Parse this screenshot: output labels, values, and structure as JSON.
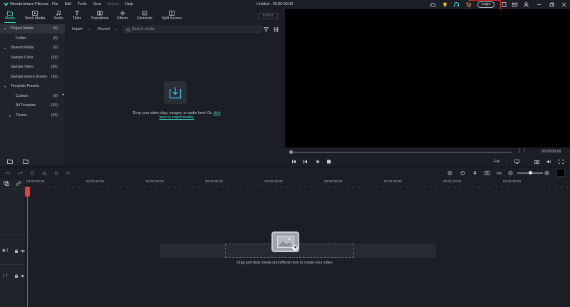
{
  "titlebar": {
    "app_name": "Wondershare Filmora",
    "menu": [
      "File",
      "Edit",
      "Tools",
      "View",
      "Export",
      "Help"
    ],
    "document_title": "Untitled : 00:00:00:00",
    "login_label": "Login"
  },
  "tabs": [
    {
      "label": "Media",
      "icon": "folder-icon",
      "active": true
    },
    {
      "label": "Stock Media",
      "icon": "stock-media-icon"
    },
    {
      "label": "Audio",
      "icon": "music-note-icon"
    },
    {
      "label": "Titles",
      "icon": "titles-icon"
    },
    {
      "label": "Transitions",
      "icon": "transitions-icon"
    },
    {
      "label": "Effects",
      "icon": "effects-icon"
    },
    {
      "label": "Elements",
      "icon": "elements-icon"
    },
    {
      "label": "Split Screen",
      "icon": "split-screen-icon"
    }
  ],
  "export_label": "Export",
  "tree": [
    {
      "label": "Project Media",
      "count": "(0)",
      "caret": "▾",
      "indent": 0,
      "selected": true
    },
    {
      "label": "Folder",
      "count": "(0)",
      "caret": "",
      "indent": 1
    },
    {
      "label": "Shared Media",
      "count": "(0)",
      "caret": "▸",
      "indent": 0
    },
    {
      "label": "Sample Color",
      "count": "(25)",
      "caret": "",
      "indent": 0
    },
    {
      "label": "Sample Video",
      "count": "(20)",
      "caret": "",
      "indent": 0
    },
    {
      "label": "Sample Green Screen",
      "count": "(10)",
      "caret": "",
      "indent": 0
    },
    {
      "label": "Template Presets",
      "count": "",
      "caret": "▾",
      "indent": 0
    },
    {
      "label": "Custom",
      "count": "(0)",
      "caret": "",
      "indent": 1
    },
    {
      "label": "All Template",
      "count": "(10)",
      "caret": "",
      "indent": 1
    },
    {
      "label": "Theme",
      "count": "(10)",
      "caret": "▸",
      "indent": 1
    }
  ],
  "media": {
    "import_label": "Import",
    "record_label": "Record",
    "search_placeholder": "Search media",
    "drop_text_1": "Drop your video clips, images, or audio here! Or,",
    "drop_link_1": "click",
    "drop_link_2": "here to import media."
  },
  "preview": {
    "timecode": "00:00:00:00",
    "quality": "Full"
  },
  "timeline": {
    "ruler": [
      "00:00:00:00",
      "00:00:10:00",
      "00:00:20:00",
      "00:00:30:00",
      "00:00:40:00",
      "00:00:50:00",
      "00:01:00:00",
      "00:01:10:00",
      "00:01:20:00"
    ],
    "drop_text": "Drag and drop media and effects here to create your video.",
    "track_labels": [
      "1",
      "1"
    ]
  },
  "colors": {
    "accent": "#3fe0c8",
    "highlight_red": "#e0232b",
    "playhead": "#e6423c",
    "panel_bg": "#1b1e24"
  }
}
